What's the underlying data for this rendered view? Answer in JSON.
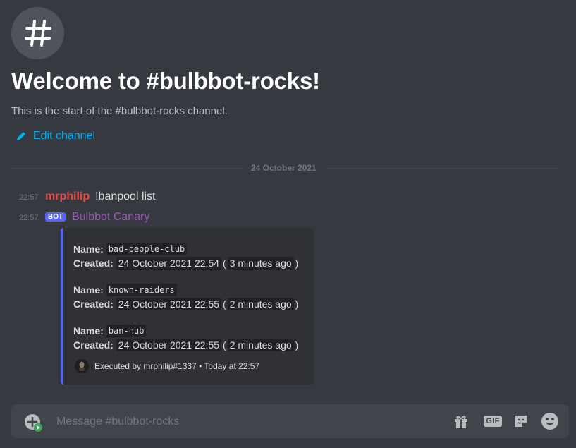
{
  "welcome": {
    "icon": "hashtag-icon",
    "title": "Welcome to #bulbbot-rocks!",
    "subtitle": "This is the start of the #bulbbot-rocks channel.",
    "edit_label": "Edit channel",
    "edit_icon": "pencil-icon"
  },
  "date_divider": "24 October 2021",
  "messages": [
    {
      "time": "22:57",
      "author": "mrphilip",
      "author_color": "#f04747",
      "text": "!banpool list"
    },
    {
      "time": "22:57",
      "badge": "BOT",
      "author": "Bulbbot Canary",
      "author_color": "#9b59b6"
    }
  ],
  "embed": {
    "accent": "#5865f2",
    "entries": [
      {
        "name_label": "Name:",
        "name": "bad-people-club",
        "created_label": "Created:",
        "date": "24 October 2021 22:54",
        "relative": "3 minutes ago"
      },
      {
        "name_label": "Name:",
        "name": "known-raiders",
        "created_label": "Created:",
        "date": "24 October 2021 22:55",
        "relative": "2 minutes ago"
      },
      {
        "name_label": "Name:",
        "name": "ban-hub",
        "created_label": "Created:",
        "date": "24 October 2021 22:55",
        "relative": "2 minutes ago"
      }
    ],
    "footer": "Executed by mrphilip#1337 • Today at 22:57"
  },
  "composer": {
    "placeholder": "Message #bulbbot-rocks",
    "gif_label": "GIF",
    "icons": [
      "add-attachment-icon",
      "gift-icon",
      "gif-icon",
      "sticker-icon",
      "emoji-icon"
    ]
  },
  "colors": {
    "background": "#36393f",
    "embed_bg": "#2f3136",
    "link": "#00aff4",
    "composer_bg": "#40444b"
  }
}
